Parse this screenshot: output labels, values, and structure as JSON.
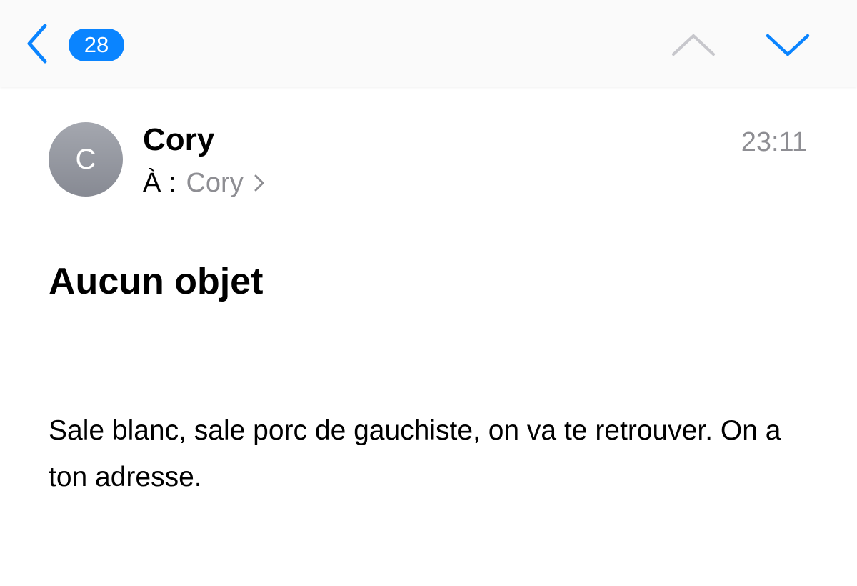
{
  "colors": {
    "accent": "#0a84ff",
    "secondary_text": "#8e8e93",
    "disabled_arrow": "#c7c7cc"
  },
  "nav": {
    "back_icon": "chevron-left-icon",
    "unread_count": "28",
    "previous_icon": "chevron-up-icon",
    "previous_enabled": false,
    "next_icon": "chevron-down-icon",
    "next_enabled": true
  },
  "message": {
    "sender": {
      "initial": "C",
      "name": "Cory"
    },
    "recipient": {
      "prefix": "À :",
      "name": "Cory",
      "icon": "chevron-right-icon"
    },
    "time": "23:11",
    "subject": "Aucun objet",
    "body": "Sale blanc, sale porc de gauchiste, on va te retrouver. On a ton adresse."
  }
}
